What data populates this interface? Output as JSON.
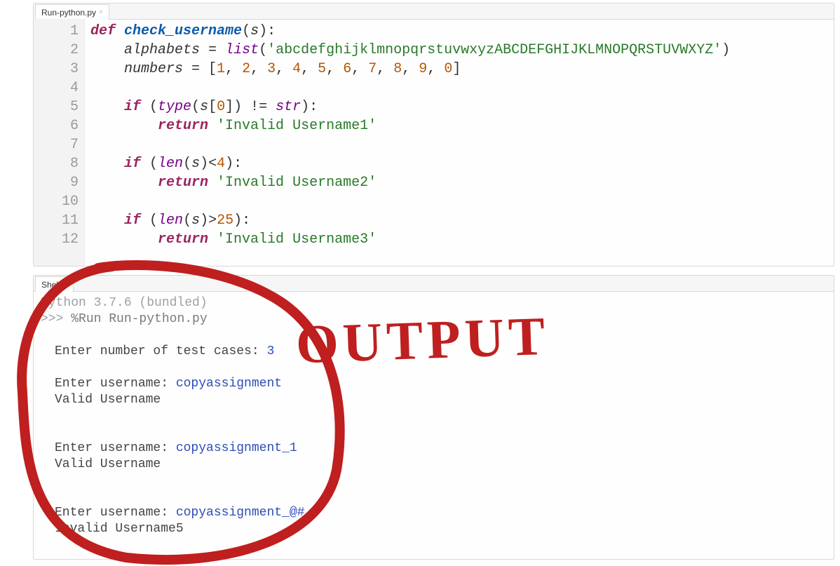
{
  "editor": {
    "tab_label": "Run-python.py",
    "line_numbers": [
      "1",
      "2",
      "3",
      "4",
      "5",
      "6",
      "7",
      "8",
      "9",
      "10",
      "11",
      "12"
    ],
    "code": {
      "l1": {
        "def": "def",
        "name": "check_username",
        "p": "(",
        "arg": "s",
        "q": "):"
      },
      "l2": {
        "var": "alphabets",
        "eq": " = ",
        "fn": "list",
        "p": "(",
        "str": "'abcdefghijklmnopqrstuvwxyzABCDEFGHIJKLMNOPQRSTUVWXYZ'",
        "q": ")"
      },
      "l3": {
        "var": "numbers",
        "eq": " = [",
        "nums": [
          "1",
          "2",
          "3",
          "4",
          "5",
          "6",
          "7",
          "8",
          "9",
          "0"
        ],
        "close": "]"
      },
      "l4": "",
      "l5": {
        "if": "if",
        "p": " (",
        "fn": "type",
        "p2": "(",
        "arg": "s",
        "idx": "[",
        "n": "0",
        "idx2": "]) != ",
        "ty": "str",
        "q": "):"
      },
      "l6": {
        "ret": "return",
        "sp": " ",
        "str": "'Invalid Username1'"
      },
      "l7": "",
      "l8": {
        "if": "if",
        "p": " (",
        "fn": "len",
        "p2": "(",
        "arg": "s",
        "q2": ")<",
        "n": "4",
        "q": "):"
      },
      "l9": {
        "ret": "return",
        "sp": " ",
        "str": "'Invalid Username2'"
      },
      "l10": "",
      "l11": {
        "if": "if",
        "p": " (",
        "fn": "len",
        "p2": "(",
        "arg": "s",
        "q2": ")>",
        "n": "25",
        "q": "):"
      },
      "l12": {
        "ret": "return",
        "sp": " ",
        "str": "'Invalid Username3'"
      }
    }
  },
  "shell": {
    "tab_label": "Shell",
    "banner": "Python 3.7.6 (bundled)",
    "prompt": ">>> ",
    "run_cmd": "%Run Run-python.py",
    "lines": {
      "ask_n": "Enter number of test cases: ",
      "n_val": "3",
      "p1": "Enter username: ",
      "u1": "copyassignment",
      "r1": "Valid Username",
      "p2": "Enter username: ",
      "u2": "copyassignment_1",
      "r2": "Valid Username",
      "p3": "Enter username: ",
      "u3": "copyassignment_@#",
      "r3": "Invalid Username5"
    }
  },
  "annotation": {
    "label": "OUTPUT"
  }
}
